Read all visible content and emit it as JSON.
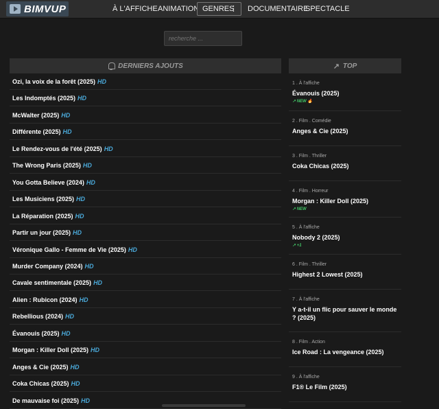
{
  "brand": {
    "name": "BIMVUP"
  },
  "nav": [
    {
      "label": "À L'AFFICHE"
    },
    {
      "label": "ANIMATION"
    },
    {
      "label": "GENRES"
    },
    {
      "label": "DOCUMENTAIRE"
    },
    {
      "label": "SPECTACLE"
    }
  ],
  "search": {
    "placeholder": "recherche ..."
  },
  "latest": {
    "heading": "DERNIERS AJOUTS",
    "items": [
      {
        "title": "Ozi, la voix de la forêt (2025)",
        "quality": "HD"
      },
      {
        "title": "Les Indomptés (2025)",
        "quality": "HD"
      },
      {
        "title": "McWalter (2025)",
        "quality": "HD"
      },
      {
        "title": "Différente (2025)",
        "quality": "HD"
      },
      {
        "title": "Le Rendez-vous de l'été (2025)",
        "quality": "HD"
      },
      {
        "title": "The Wrong Paris (2025)",
        "quality": "HD"
      },
      {
        "title": "You Gotta Believe (2024)",
        "quality": "HD"
      },
      {
        "title": "Les Musiciens (2025)",
        "quality": "HD"
      },
      {
        "title": "La Réparation (2025)",
        "quality": "HD"
      },
      {
        "title": "Partir un jour (2025)",
        "quality": "HD"
      },
      {
        "title": "Véronique Gallo - Femme de Vie (2025)",
        "quality": "HD"
      },
      {
        "title": "Murder Company (2024)",
        "quality": "HD"
      },
      {
        "title": "Cavale sentimentale (2025)",
        "quality": "HD"
      },
      {
        "title": "Alien : Rubicon (2024)",
        "quality": "HD"
      },
      {
        "title": "Rebellious (2024)",
        "quality": "HD"
      },
      {
        "title": "Évanouis (2025)",
        "quality": "HD"
      },
      {
        "title": "Morgan : Killer Doll (2025)",
        "quality": "HD"
      },
      {
        "title": "Anges & Cie (2025)",
        "quality": "HD"
      },
      {
        "title": "Coka Chicas (2025)",
        "quality": "HD"
      },
      {
        "title": "De mauvaise foi (2025)",
        "quality": "HD"
      }
    ]
  },
  "top": {
    "heading": "TOP",
    "items": [
      {
        "meta": "1 . À l'affiche",
        "title": "Évanouis (2025)",
        "badge": "NEW 🔥"
      },
      {
        "meta": "2 . Film . Comédie",
        "title": "Anges & Cie (2025)",
        "badge": ""
      },
      {
        "meta": "3 . Film . Thriller",
        "title": "Coka Chicas (2025)",
        "badge": ""
      },
      {
        "meta": "4 . Film . Horreur",
        "title": "Morgan : Killer Doll (2025)",
        "badge": "NEW"
      },
      {
        "meta": "5 . À l'affiche",
        "title": "Nobody 2 (2025)",
        "badge": "+1"
      },
      {
        "meta": "6 . Film . Thriller",
        "title": "Highest 2 Lowest (2025)",
        "badge": ""
      },
      {
        "meta": "7 . À l'affiche",
        "title": "Y a-t-il un flic pour sauver le monde ? (2025)",
        "badge": ""
      },
      {
        "meta": "8 . Film . Action",
        "title": "Ice Road : La vengeance (2025)",
        "badge": ""
      },
      {
        "meta": "9 . À l'affiche",
        "title": "F1® Le Film (2025)",
        "badge": ""
      }
    ]
  },
  "colors": {
    "accent_hd": "#4aa8d8",
    "trend_green": "#43c968",
    "background": "#1a1a1a",
    "topbar": "#2d2d2d"
  }
}
